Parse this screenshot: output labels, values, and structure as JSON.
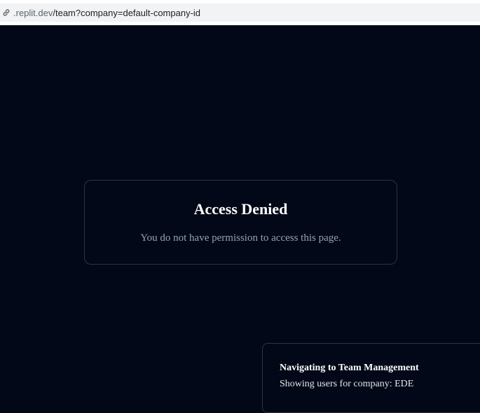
{
  "browser": {
    "url_host": ".replit.dev",
    "url_path": "/team?company=default-company-id"
  },
  "access_card": {
    "title": "Access Denied",
    "message": "You do not have permission to access this page."
  },
  "toast": {
    "title": "Navigating to Team Management",
    "description": "Showing users for company: EDE"
  },
  "colors": {
    "background": "#020817",
    "border": "#2a3346",
    "muted_text": "#94a3b8"
  }
}
